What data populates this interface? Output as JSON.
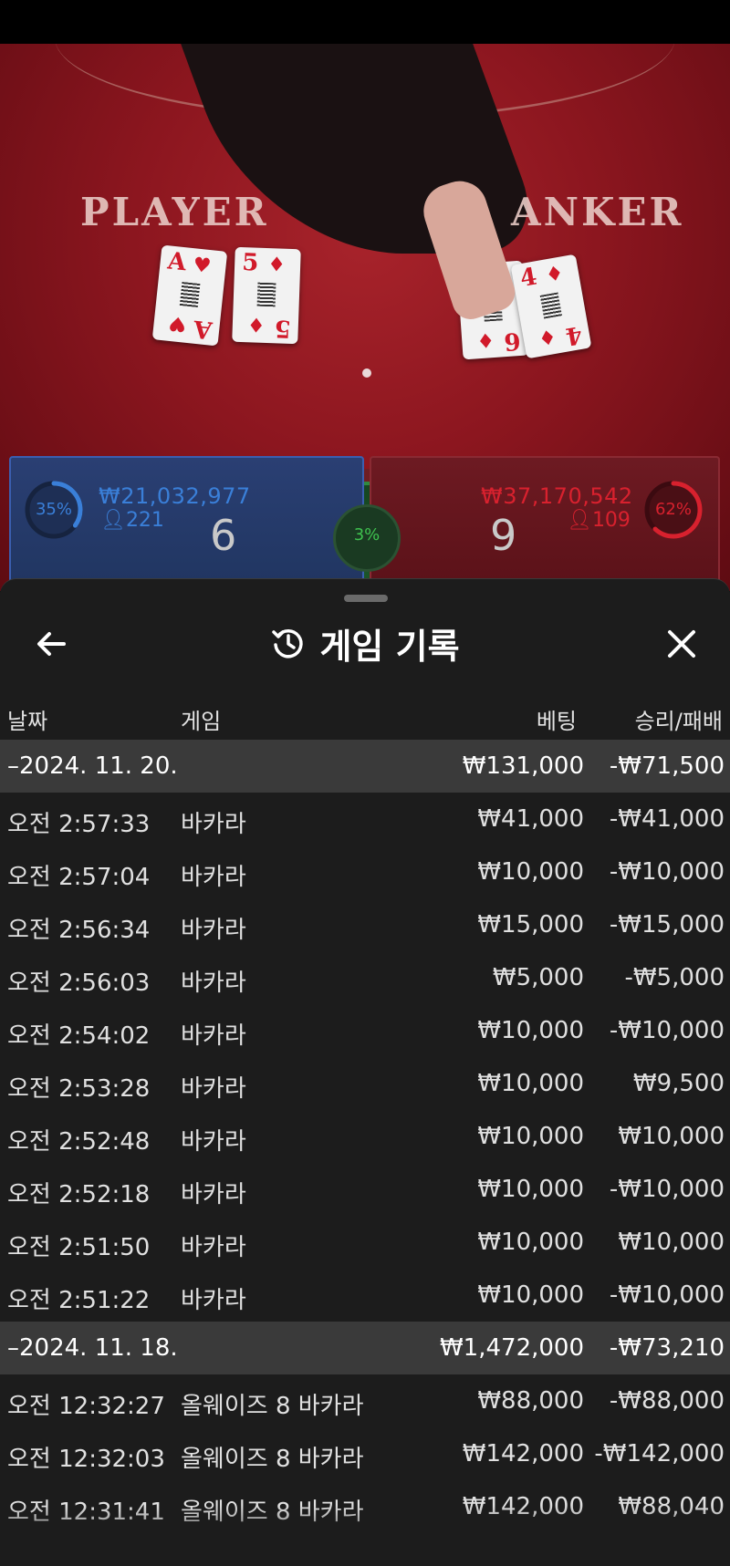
{
  "colors": {
    "player_blue": "#3a7fd8",
    "banker_red": "#d8212e",
    "tie_green": "#3fc24f",
    "sheet_bg": "#1c1c1c",
    "group_bg": "#3a3a3a"
  },
  "video": {
    "player_label": "PLAYER",
    "banker_label": "ANKER",
    "player_cards": [
      {
        "rank": "A",
        "suit": "♥"
      },
      {
        "rank": "5",
        "suit": "♦"
      }
    ],
    "banker_cards": [
      {
        "rank": "6",
        "suit": "♦"
      },
      {
        "rank": "4",
        "suit": "♦"
      }
    ]
  },
  "bets": {
    "player": {
      "percent": "35%",
      "amount": "₩21,032,977",
      "players": "221",
      "score": "6",
      "percent_value": 35
    },
    "tie": {
      "percent": "3%",
      "percent_value": 3
    },
    "banker": {
      "percent": "62%",
      "amount": "₩37,170,542",
      "players": "109",
      "score": "9",
      "percent_value": 62
    }
  },
  "sheet": {
    "title": "게임 기록",
    "icons": {
      "back": "arrow-left-icon",
      "history": "history-icon",
      "close": "close-icon"
    },
    "columns": {
      "date": "날짜",
      "game": "게임",
      "bet": "베팅",
      "win_loss": "승리/패배"
    },
    "groups": [
      {
        "date": "–2024. 11. 20.",
        "bet": "₩131,000",
        "win_loss": "-₩71,500",
        "rows": [
          {
            "time": "오전 2:57:33",
            "game": "바카라",
            "bet": "₩41,000",
            "win_loss": "-₩41,000"
          },
          {
            "time": "오전 2:57:04",
            "game": "바카라",
            "bet": "₩10,000",
            "win_loss": "-₩10,000"
          },
          {
            "time": "오전 2:56:34",
            "game": "바카라",
            "bet": "₩15,000",
            "win_loss": "-₩15,000"
          },
          {
            "time": "오전 2:56:03",
            "game": "바카라",
            "bet": "₩5,000",
            "win_loss": "-₩5,000"
          },
          {
            "time": "오전 2:54:02",
            "game": "바카라",
            "bet": "₩10,000",
            "win_loss": "-₩10,000"
          },
          {
            "time": "오전 2:53:28",
            "game": "바카라",
            "bet": "₩10,000",
            "win_loss": "₩9,500"
          },
          {
            "time": "오전 2:52:48",
            "game": "바카라",
            "bet": "₩10,000",
            "win_loss": "₩10,000"
          },
          {
            "time": "오전 2:52:18",
            "game": "바카라",
            "bet": "₩10,000",
            "win_loss": "-₩10,000"
          },
          {
            "time": "오전 2:51:50",
            "game": "바카라",
            "bet": "₩10,000",
            "win_loss": "₩10,000"
          },
          {
            "time": "오전 2:51:22",
            "game": "바카라",
            "bet": "₩10,000",
            "win_loss": "-₩10,000"
          }
        ]
      },
      {
        "date": "–2024. 11. 18.",
        "bet": "₩1,472,000",
        "win_loss": "-₩73,210",
        "rows": [
          {
            "time": "오전 12:32:27",
            "game": "올웨이즈 8 바카라",
            "bet": "₩88,000",
            "win_loss": "-₩88,000"
          },
          {
            "time": "오전 12:32:03",
            "game": "올웨이즈 8 바카라",
            "bet": "₩142,000",
            "win_loss": "-₩142,000"
          },
          {
            "time": "오전 12:31:41",
            "game": "올웨이즈 8 바카라",
            "bet": "₩142,000",
            "win_loss": "₩88,040"
          }
        ]
      }
    ]
  }
}
